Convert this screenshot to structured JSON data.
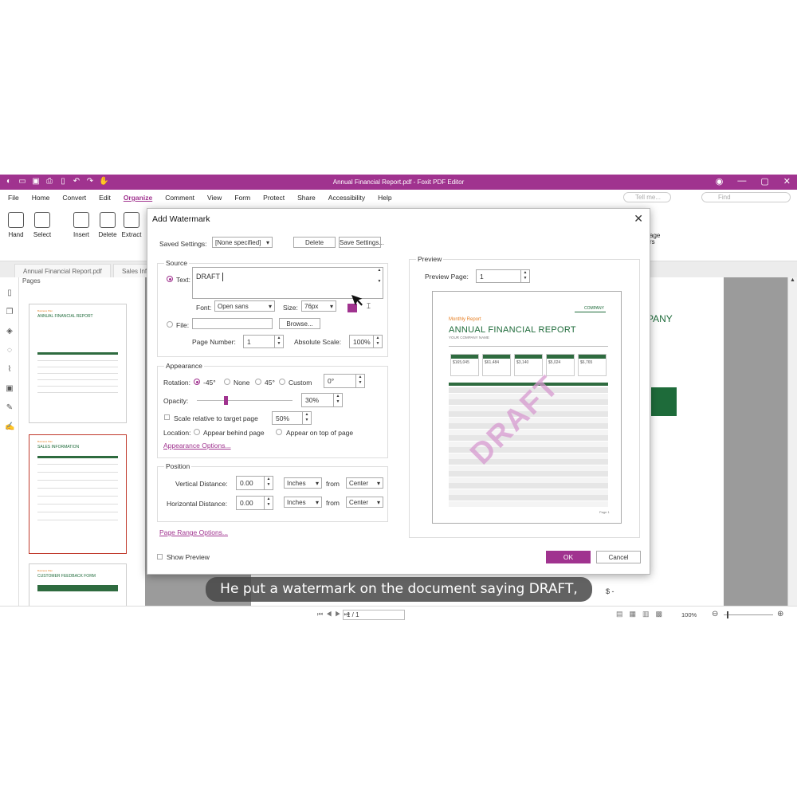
{
  "titlebar": {
    "title": "Annual Financial Report.pdf - Foxit PDF Editor",
    "window_controls": [
      "—",
      "▢",
      "✕"
    ]
  },
  "menu": {
    "items": [
      "File",
      "Home",
      "Convert",
      "Edit",
      "Organize",
      "Comment",
      "View",
      "Form",
      "Protect",
      "Share",
      "Accessibility",
      "Help"
    ],
    "active": "Organize",
    "tell_me_placeholder": "Tell me...",
    "find_placeholder": "Find"
  },
  "ribbon": {
    "buttons": [
      "Hand",
      "Select",
      "Insert",
      "Delete",
      "Extract"
    ],
    "partial_right": "age\nrs"
  },
  "tabs": [
    "Annual Financial Report.pdf",
    "Sales Inf"
  ],
  "pages_panel": {
    "header": "Pages",
    "thumbs": [
      {
        "small": "Business Plan",
        "title": "ANNUAL FINANCIAL REPORT"
      },
      {
        "small": "Business Plan",
        "title": "SALES INFORMATION"
      },
      {
        "small": "Business Plan",
        "title": "CUSTOMER FEEDBACK FORM"
      }
    ]
  },
  "document": {
    "visible_company": "PANY",
    "dollar": "$ -"
  },
  "status": {
    "page": "1 / 1",
    "zoom": "100%"
  },
  "dialog": {
    "title": "Add Watermark",
    "saved_settings_label": "Saved Settings:",
    "saved_settings_value": "[None specified]",
    "delete_button": "Delete",
    "save_settings_button": "Save Settings...",
    "source": {
      "group": "Source",
      "text_label": "Text:",
      "text_value": "DRAFT",
      "font_label": "Font:",
      "font_value": "Open sans",
      "size_label": "Size:",
      "size_value": "76px",
      "color": "#a0338f",
      "file_label": "File:",
      "browse_button": "Browse...",
      "page_number_label": "Page Number:",
      "page_number_value": "1",
      "absolute_scale_label": "Absolute Scale:",
      "absolute_scale_value": "100%"
    },
    "appearance": {
      "group": "Appearance",
      "rotation_label": "Rotation:",
      "rotation_options": [
        "-45°",
        "None",
        "45°",
        "Custom"
      ],
      "rotation_selected": "-45°",
      "custom_value": "0°",
      "opacity_label": "Opacity:",
      "opacity_value": "30%",
      "opacity_fraction": 0.3,
      "scale_label": "Scale relative to target page",
      "scale_value": "50%",
      "location_label": "Location:",
      "behind_label": "Appear behind page",
      "on_top_label": "Appear on top of page",
      "options_link": "Appearance Options..."
    },
    "position": {
      "group": "Position",
      "vertical_label": "Vertical Distance:",
      "vertical_value": "0.00",
      "vertical_unit": "Inches",
      "vertical_from_label": "from",
      "vertical_from": "Center",
      "horizontal_label": "Horizontal Distance:",
      "horizontal_value": "0.00",
      "horizontal_unit": "Inches",
      "horizontal_from_label": "from",
      "horizontal_from": "Center"
    },
    "page_range_link": "Page Range Options...",
    "show_preview_label": "Show Preview",
    "ok_button": "OK",
    "cancel_button": "Cancel",
    "preview": {
      "group": "Preview",
      "preview_page_label": "Preview Page:",
      "preview_page_value": "1",
      "doc_small": "Monthly Report",
      "doc_title": "ANNUAL FINANCIAL REPORT",
      "doc_company": "YOUR COMPANY NAME",
      "logo_text": "COMPANY",
      "cards": [
        "$165,045",
        "$61,484",
        "$3,140",
        "$5,024",
        "$6,765"
      ],
      "watermark_text": "DRAFT",
      "page_label": "Page 1"
    }
  },
  "caption": "He put a watermark on the document saying DRAFT,"
}
